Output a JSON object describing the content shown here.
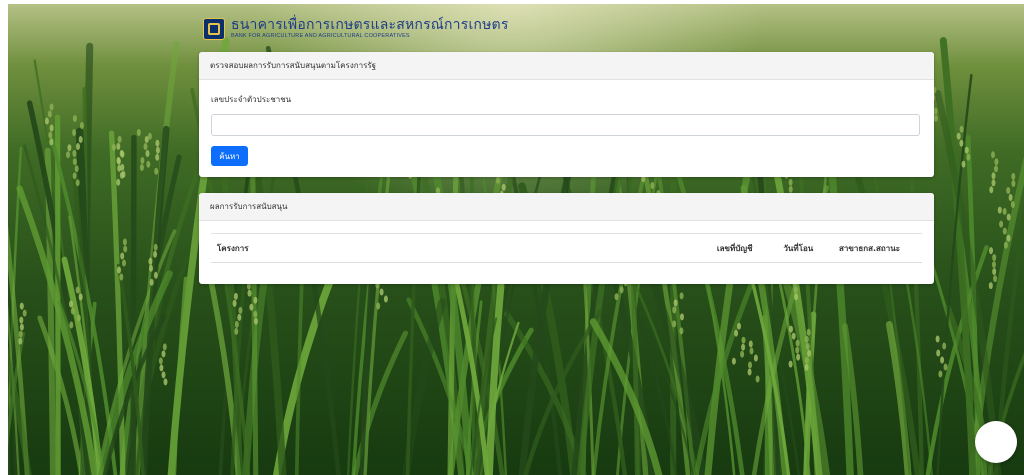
{
  "logo": {
    "thai_name": "ธนาคารเพื่อการเกษตรและสหกรณ์การเกษตร",
    "english_name": "BANK FOR AGRICULTURE AND AGRICULTURAL COOPERATIVES"
  },
  "search_card": {
    "title": "ตรวจสอบผลการรับการสนับสนุนตามโครงการรัฐ",
    "id_label": "เลขประจำตัวประชาชน",
    "id_value": "",
    "search_button": "ค้นหา"
  },
  "result_card": {
    "title": "ผลการรับการสนับสนุน",
    "columns": [
      "โครงการ",
      "เลขที่บัญชี",
      "วันที่โอน",
      "สาขาธกส.",
      "สถานะ"
    ]
  },
  "colors": {
    "primary_button": "#0d6efd",
    "card_header": "#f4f4f4",
    "logo_blue": "#1f3c86"
  },
  "icons": {
    "logo": "baac-logo-icon",
    "floating_button": "circle-button"
  }
}
